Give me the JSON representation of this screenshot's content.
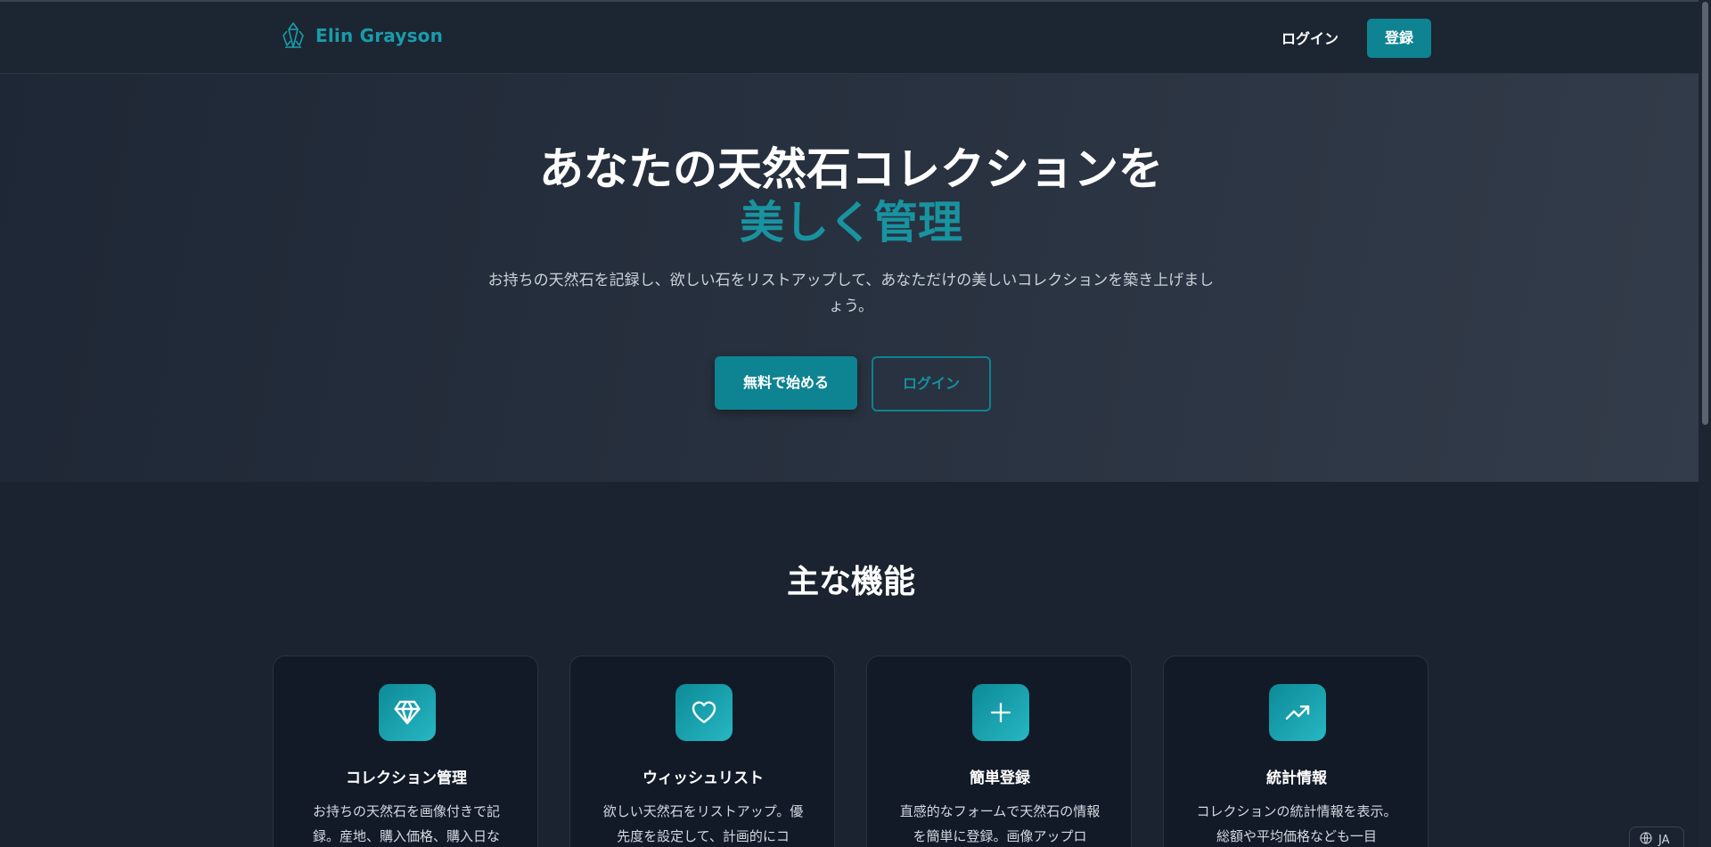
{
  "header": {
    "brand": "Elin Grayson",
    "login_label": "ログイン",
    "register_label": "登録"
  },
  "hero": {
    "title_line1": "あなたの天然石コレクションを",
    "title_line2": "美しく管理",
    "subtitle": "お持ちの天然石を記録し、欲しい石をリストアップして、あなただけの美しいコレクションを築き上げましょう。",
    "start_label": "無料で始める",
    "login_label": "ログイン"
  },
  "features": {
    "title": "主な機能",
    "cards": [
      {
        "icon": "gem-icon",
        "title": "コレクション管理",
        "desc": "お持ちの天然石を画像付きで記録。産地、購入価格、購入日な"
      },
      {
        "icon": "heart-icon",
        "title": "ウィッシュリスト",
        "desc": "欲しい天然石をリストアップ。優先度を設定して、計画的にコ"
      },
      {
        "icon": "plus-icon",
        "title": "簡単登録",
        "desc": "直感的なフォームで天然石の情報を簡単に登録。画像アップロ"
      },
      {
        "icon": "trending-up-icon",
        "title": "統計情報",
        "desc": "コレクションの統計情報を表示。総額や平均価格なども一目"
      }
    ]
  },
  "language": {
    "code": "JA"
  },
  "colors": {
    "accent": "#0e8391",
    "accent_text": "#18939f",
    "background": "#1b2330",
    "card": "#121a27"
  }
}
